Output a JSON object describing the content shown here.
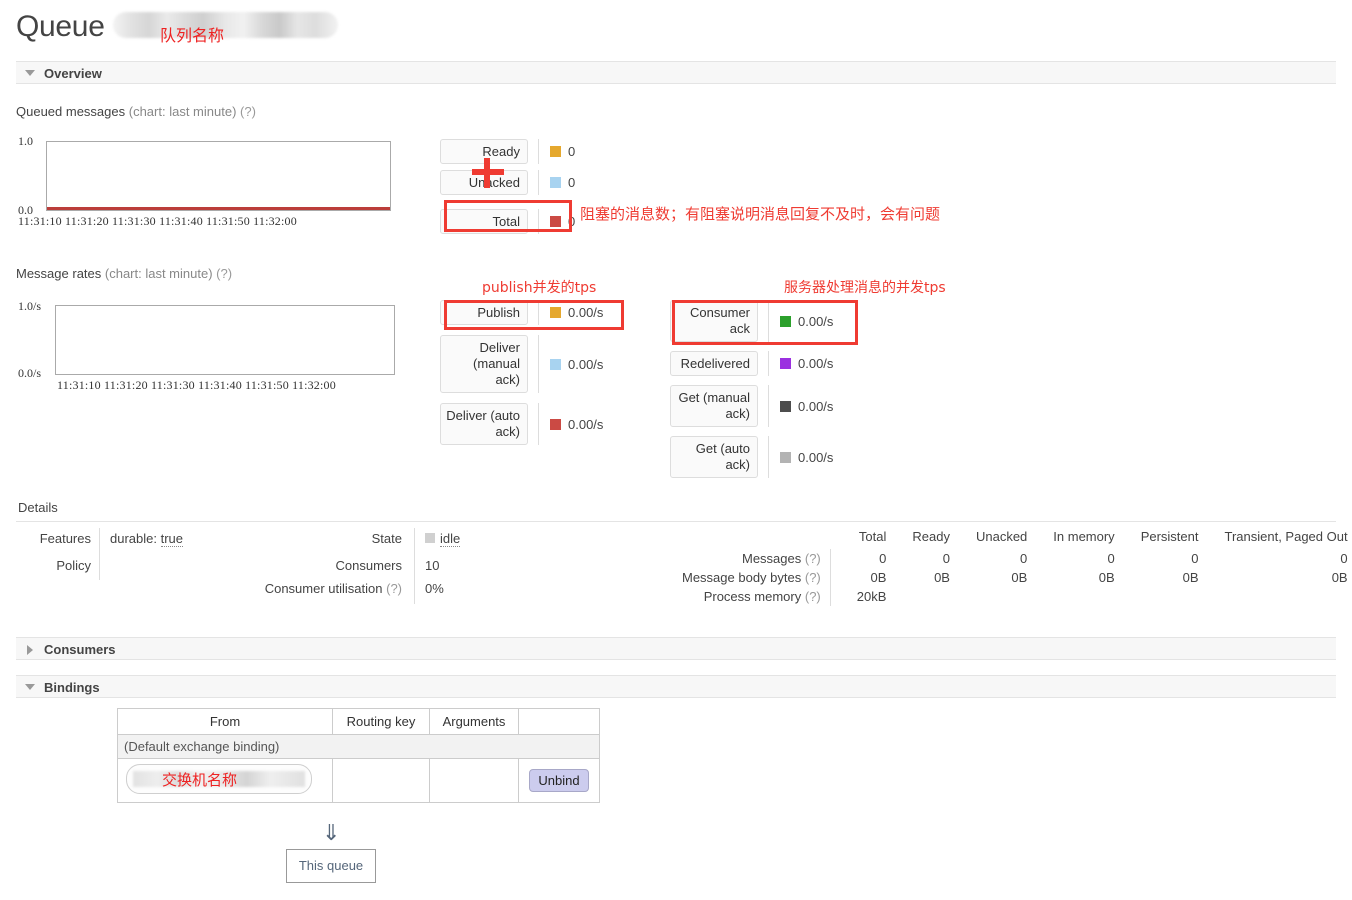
{
  "page": {
    "title": "Queue",
    "queue_name_annotation": "队列名称"
  },
  "sections": {
    "overview": {
      "label": "Overview",
      "expanded": true
    },
    "consumers": {
      "label": "Consumers",
      "expanded": false
    },
    "bindings": {
      "label": "Bindings",
      "expanded": true
    },
    "details": {
      "label": "Details"
    }
  },
  "queued_messages": {
    "caption_main": "Queued messages",
    "caption_muted": "(chart: last minute)",
    "caption_help": "(?)",
    "legend": [
      {
        "name": "Ready",
        "value": "0",
        "color": "#e5a82e"
      },
      {
        "name": "Unacked",
        "value": "0",
        "color": "#a8d3f0"
      },
      {
        "name": "Total",
        "value": "0",
        "color": "#cb4a44"
      }
    ]
  },
  "message_rates": {
    "caption_main": "Message rates",
    "caption_muted": "(chart: last minute)",
    "caption_help": "(?)",
    "legend_left": [
      {
        "name": "Publish",
        "value": "0.00/s",
        "color": "#e5a82e"
      },
      {
        "name": "Deliver (manual ack)",
        "value": "0.00/s",
        "color": "#a8d3f0"
      },
      {
        "name": "Deliver (auto ack)",
        "value": "0.00/s",
        "color": "#cb4a44"
      }
    ],
    "legend_right": [
      {
        "name": "Consumer ack",
        "value": "0.00/s",
        "color": "#2ca02c"
      },
      {
        "name": "Redelivered",
        "value": "0.00/s",
        "color": "#9b30e0"
      },
      {
        "name": "Get (manual ack)",
        "value": "0.00/s",
        "color": "#4d4d4d"
      },
      {
        "name": "Get (auto ack)",
        "value": "0.00/s",
        "color": "#b3b3b3"
      }
    ]
  },
  "annotations": {
    "total_blocked": "阻塞的消息数；有阻塞说明消息回复不及时，会有问题",
    "publish_tps": "publish并发的tps",
    "consumer_tps": "服务器处理消息的并发tps",
    "exchange_name": "交换机名称"
  },
  "details": {
    "features_label": "Features",
    "features_value_prefix": "durable:",
    "features_value": "true",
    "policy_label": "Policy",
    "policy_value": "",
    "state_label": "State",
    "state_value": "idle",
    "consumers_label": "Consumers",
    "consumers_value": "10",
    "utilisation_label": "Consumer utilisation",
    "utilisation_help": "(?)",
    "utilisation_value": "0%"
  },
  "stats": {
    "columns": [
      "Total",
      "Ready",
      "Unacked",
      "In memory",
      "Persistent",
      "Transient, Paged Out"
    ],
    "rows": [
      {
        "label": "Messages",
        "help": "(?)",
        "values": [
          "0",
          "0",
          "0",
          "0",
          "0",
          "0"
        ]
      },
      {
        "label": "Message body bytes",
        "help": "(?)",
        "values": [
          "0B",
          "0B",
          "0B",
          "0B",
          "0B",
          "0B"
        ]
      },
      {
        "label": "Process memory",
        "help": "(?)",
        "values": [
          "20kB",
          "",
          "",
          "",
          "",
          ""
        ]
      }
    ]
  },
  "bindings": {
    "columns": [
      "From",
      "Routing key",
      "Arguments",
      ""
    ],
    "default_row": "(Default exchange binding)",
    "row": {
      "routing_key": "",
      "arguments": "",
      "unbind_label": "Unbind"
    }
  },
  "footer": {
    "arrow": "⇓",
    "this_queue_label": "This queue"
  },
  "charts": {
    "queued_messages": {
      "y_max": "1.0",
      "y_min": "0.0",
      "x_ticks": "11:31:10 11:31:20 11:31:30 11:31:40 11:31:50 11:32:00"
    },
    "message_rates": {
      "y_max": "1.0/s",
      "y_min": "0.0/s",
      "x_ticks": "11:31:10 11:31:20 11:31:30 11:31:40 11:31:50 11:32:00"
    }
  }
}
